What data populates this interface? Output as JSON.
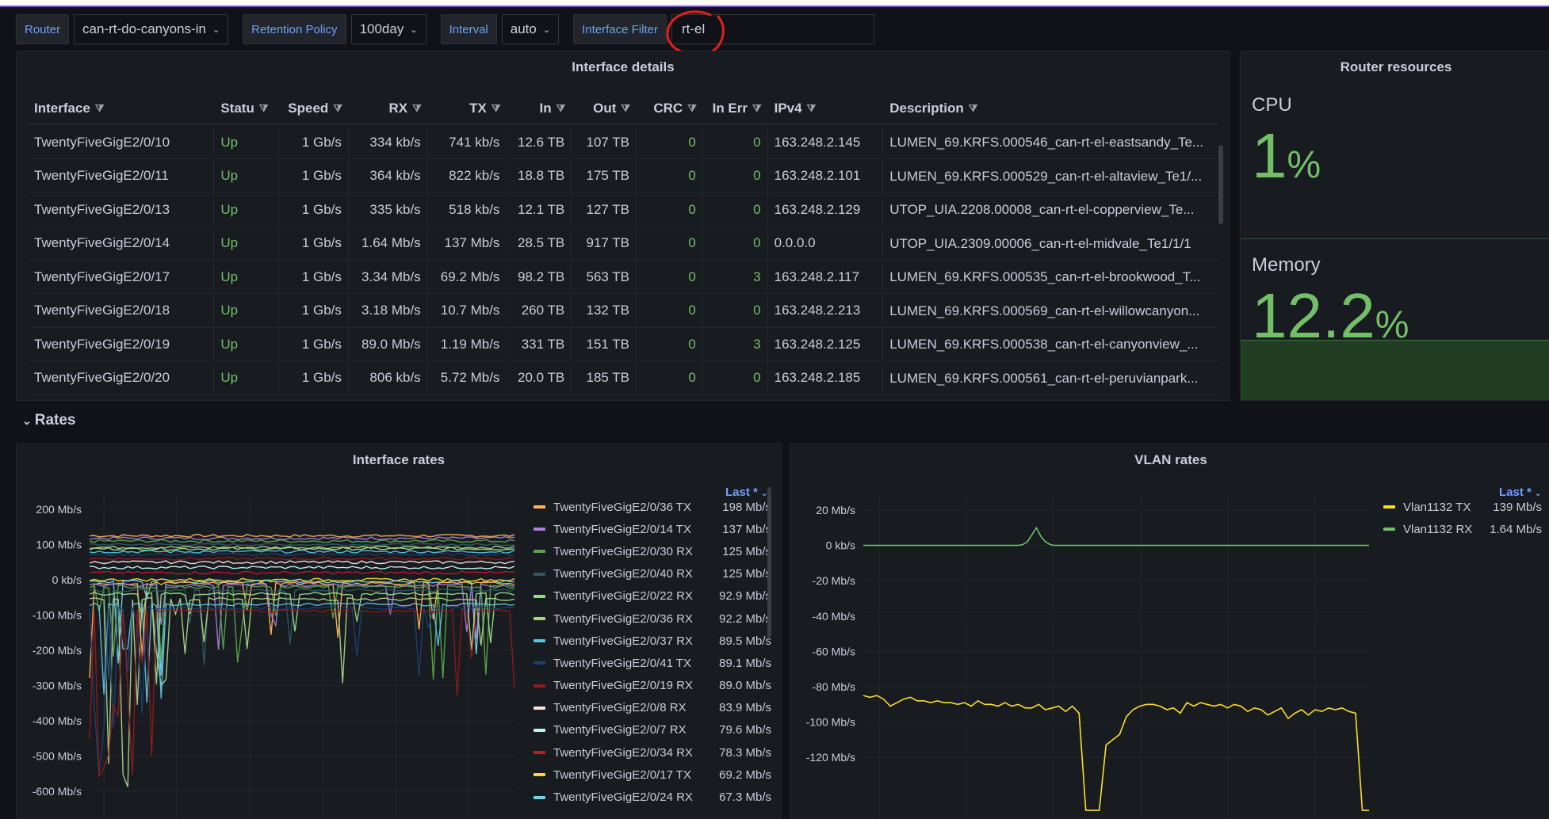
{
  "variables": {
    "router_label": "Router",
    "router_value": "can-rt-do-canyons-in",
    "retention_label": "Retention Policy",
    "retention_value": "100day",
    "interval_label": "Interval",
    "interval_value": "auto",
    "filter_label": "Interface Filter",
    "filter_value": "rt-el"
  },
  "interface_details": {
    "title": "Interface details",
    "columns": [
      "Interface",
      "Statu",
      "Speed",
      "RX",
      "TX",
      "In",
      "Out",
      "CRC",
      "In Err",
      "IPv4",
      "Description"
    ],
    "rows": [
      [
        "TwentyFiveGigE2/0/10",
        "Up",
        "1 Gb/s",
        "334 kb/s",
        "741 kb/s",
        "12.6 TB",
        "107 TB",
        "0",
        "0",
        "163.248.2.145",
        "LUMEN_69.KRFS.000546_can-rt-el-eastsandy_Te..."
      ],
      [
        "TwentyFiveGigE2/0/11",
        "Up",
        "1 Gb/s",
        "364 kb/s",
        "822 kb/s",
        "18.8 TB",
        "175 TB",
        "0",
        "0",
        "163.248.2.101",
        "LUMEN_69.KRFS.000529_can-rt-el-altaview_Te1/..."
      ],
      [
        "TwentyFiveGigE2/0/13",
        "Up",
        "1 Gb/s",
        "335 kb/s",
        "518 kb/s",
        "12.1 TB",
        "127 TB",
        "0",
        "0",
        "163.248.2.129",
        "UTOP_UIA.2208.00008_can-rt-el-copperview_Te..."
      ],
      [
        "TwentyFiveGigE2/0/14",
        "Up",
        "1 Gb/s",
        "1.64 Mb/s",
        "137 Mb/s",
        "28.5 TB",
        "917 TB",
        "0",
        "0",
        "0.0.0.0",
        "UTOP_UIA.2309.00006_can-rt-el-midvale_Te1/1/1"
      ],
      [
        "TwentyFiveGigE2/0/17",
        "Up",
        "1 Gb/s",
        "3.34 Mb/s",
        "69.2 Mb/s",
        "98.2 TB",
        "563 TB",
        "0",
        "3",
        "163.248.2.117",
        "LUMEN_69.KRFS.000535_can-rt-el-brookwood_T..."
      ],
      [
        "TwentyFiveGigE2/0/18",
        "Up",
        "1 Gb/s",
        "3.18 Mb/s",
        "10.7 Mb/s",
        "260 TB",
        "132 TB",
        "0",
        "0",
        "163.248.2.213",
        "LUMEN_69.KRFS.000569_can-rt-el-willowcanyon..."
      ],
      [
        "TwentyFiveGigE2/0/19",
        "Up",
        "1 Gb/s",
        "89.0 Mb/s",
        "1.19 Mb/s",
        "331 TB",
        "151 TB",
        "0",
        "3",
        "163.248.2.125",
        "LUMEN_69.KRFS.000538_can-rt-el-canyonview_..."
      ],
      [
        "TwentyFiveGigE2/0/20",
        "Up",
        "1 Gb/s",
        "806 kb/s",
        "5.72 Mb/s",
        "20.0 TB",
        "185 TB",
        "0",
        "0",
        "163.248.2.185",
        "LUMEN_69.KRFS.000561_can-rt-el-peruvianpark..."
      ]
    ]
  },
  "router_resources": {
    "title": "Router resources",
    "cpu_label": "CPU",
    "cpu_value": "1",
    "cpu_unit": "%",
    "memory_label": "Memory",
    "memory_value": "12.2",
    "memory_unit": "%"
  },
  "rates_row": {
    "title": "Rates",
    "chevron": "⌄"
  },
  "legend_sort_label": "Last *",
  "colors": {
    "green": "#73bf69",
    "blue": "#6e9fff",
    "yellow": "#fade2a",
    "bg": "#111217",
    "panel": "#181b1f"
  },
  "chart_data": [
    {
      "type": "line",
      "title": "Interface rates",
      "y_ticks": [
        "200 Mb/s",
        "100 Mb/s",
        "0 kb/s",
        "-100 Mb/s",
        "-200 Mb/s",
        "-300 Mb/s",
        "-400 Mb/s",
        "-500 Mb/s",
        "-600 Mb/s"
      ],
      "ylim": [
        -650,
        250
      ],
      "legend_position": "right",
      "series": [
        {
          "name": "TwentyFiveGigE2/0/36 TX",
          "last": "198 Mb/s",
          "color": "#ffb357"
        },
        {
          "name": "TwentyFiveGigE2/0/14 TX",
          "last": "137 Mb/s",
          "color": "#a77fdc"
        },
        {
          "name": "TwentyFiveGigE2/0/30 RX",
          "last": "125 Mb/s",
          "color": "#56a64b"
        },
        {
          "name": "TwentyFiveGigE2/0/40 RX",
          "last": "125 Mb/s",
          "color": "#2f575e"
        },
        {
          "name": "TwentyFiveGigE2/0/22 RX",
          "last": "92.9 Mb/s",
          "color": "#96d98d"
        },
        {
          "name": "TwentyFiveGigE2/0/36 RX",
          "last": "92.2 Mb/s",
          "color": "#a8d48a"
        },
        {
          "name": "TwentyFiveGigE2/0/37 RX",
          "last": "89.5 Mb/s",
          "color": "#5ec2e0"
        },
        {
          "name": "TwentyFiveGigE2/0/41 TX",
          "last": "89.1 Mb/s",
          "color": "#1f3e73"
        },
        {
          "name": "TwentyFiveGigE2/0/19 RX",
          "last": "89.0 Mb/s",
          "color": "#8f1b1b"
        },
        {
          "name": "TwentyFiveGigE2/0/8 RX",
          "last": "83.9 Mb/s",
          "color": "#fce2de"
        },
        {
          "name": "TwentyFiveGigE2/0/7 RX",
          "last": "79.6 Mb/s",
          "color": "#c7f2f0"
        },
        {
          "name": "TwentyFiveGigE2/0/34 RX",
          "last": "78.3 Mb/s",
          "color": "#c4162a"
        },
        {
          "name": "TwentyFiveGigE2/0/17 TX",
          "last": "69.2 Mb/s",
          "color": "#fade2a"
        },
        {
          "name": "TwentyFiveGigE2/0/24 RX",
          "last": "67.3 Mb/s",
          "color": "#73d1ea"
        }
      ]
    },
    {
      "type": "line",
      "title": "VLAN rates",
      "y_ticks": [
        "20 Mb/s",
        "0 kb/s",
        "-20 Mb/s",
        "-40 Mb/s",
        "-60 Mb/s",
        "-80 Mb/s",
        "-100 Mb/s",
        "-120 Mb/s"
      ],
      "ylim": [
        -125,
        30
      ],
      "legend_position": "right",
      "series": [
        {
          "name": "Vlan1132 TX",
          "last": "139 Mb/s",
          "color": "#fade2a"
        },
        {
          "name": "Vlan1132 RX",
          "last": "1.64 Mb/s",
          "color": "#73bf69"
        }
      ],
      "rx_values": [
        0,
        0,
        0,
        0,
        0,
        0,
        0,
        0,
        0,
        0,
        0,
        0,
        0,
        0,
        0,
        0,
        0,
        0,
        0,
        0,
        0,
        0,
        0,
        0,
        0,
        0,
        0,
        0,
        0,
        0,
        0,
        0,
        0,
        0,
        0,
        0.5,
        2,
        6,
        10,
        5,
        2,
        0.5,
        0,
        0,
        0,
        0,
        0,
        0,
        0,
        0,
        0,
        0,
        0,
        0,
        0,
        0,
        0,
        0,
        0,
        0,
        0,
        0,
        0,
        0,
        0,
        0,
        0,
        0,
        0,
        0,
        0,
        0,
        0,
        0,
        0,
        0,
        0,
        0,
        0,
        0,
        0,
        0,
        0,
        0,
        0,
        0,
        0,
        0,
        0,
        0,
        0,
        0,
        0,
        0,
        0,
        0,
        0,
        0,
        0,
        0,
        0,
        0,
        0,
        0,
        0,
        0,
        0,
        0,
        0,
        0,
        0,
        0
      ],
      "tx_values": [
        -85,
        -86,
        -85,
        -87,
        -91,
        -89,
        -87,
        -86,
        -88,
        -88,
        -89,
        -88,
        -89,
        -89,
        -90,
        -89,
        -91,
        -88,
        -90,
        -90,
        -91,
        -89,
        -91,
        -90,
        -92,
        -92,
        -90,
        -93,
        -92,
        -91,
        -94,
        -91,
        -95,
        -150,
        -150,
        -150,
        -113,
        -110,
        -107,
        -97,
        -93,
        -91,
        -90,
        -90,
        -91,
        -93,
        -92,
        -95,
        -89,
        -91,
        -89,
        -90,
        -91,
        -90,
        -92,
        -90,
        -91,
        -94,
        -92,
        -93,
        -96,
        -94,
        -92,
        -98,
        -95,
        -93,
        -96,
        -93,
        -94,
        -92,
        -93,
        -92,
        -94,
        -95,
        -150,
        -150
      ]
    }
  ]
}
